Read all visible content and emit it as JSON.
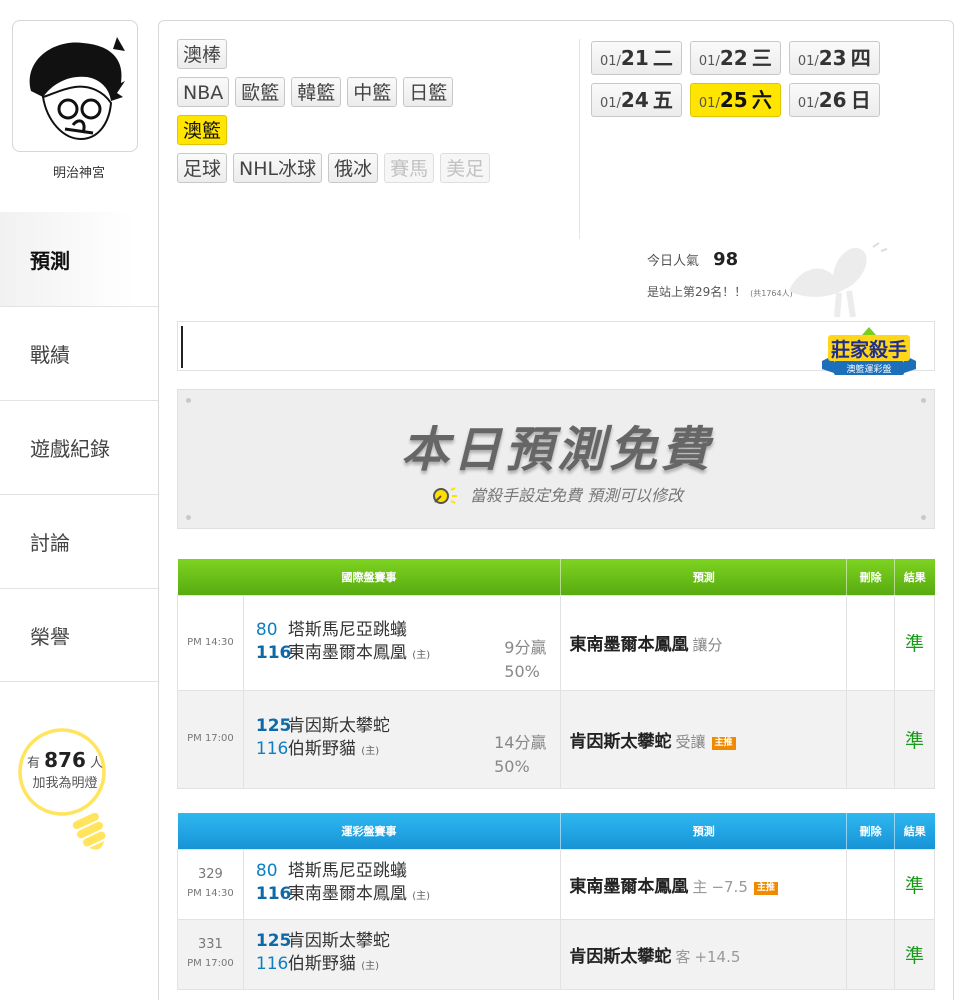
{
  "profile": {
    "name": "明治神宮"
  },
  "nav": {
    "items": [
      "預測",
      "戰績",
      "遊戲紀錄",
      "討論",
      "榮譽"
    ],
    "active_index": 0
  },
  "followers": {
    "prefix": "有",
    "count": "876",
    "suffix": "人",
    "caption": "加我為明燈"
  },
  "sports": {
    "rows": [
      [
        {
          "label": "澳棒",
          "state": "normal"
        }
      ],
      [
        {
          "label": "NBA",
          "state": "normal"
        },
        {
          "label": "歐籃",
          "state": "normal"
        },
        {
          "label": "韓籃",
          "state": "normal"
        },
        {
          "label": "中籃",
          "state": "normal"
        },
        {
          "label": "日籃",
          "state": "normal"
        }
      ],
      [
        {
          "label": "澳籃",
          "state": "active"
        }
      ],
      [
        {
          "label": "足球",
          "state": "normal"
        },
        {
          "label": "NHL冰球",
          "state": "normal"
        },
        {
          "label": "俄冰",
          "state": "normal"
        },
        {
          "label": "賽馬",
          "state": "disabled"
        },
        {
          "label": "美足",
          "state": "disabled"
        }
      ]
    ]
  },
  "dates": [
    {
      "md": "01/",
      "day": "21",
      "wd": "二",
      "active": false
    },
    {
      "md": "01/",
      "day": "22",
      "wd": "三",
      "active": false
    },
    {
      "md": "01/",
      "day": "23",
      "wd": "四",
      "active": false
    },
    {
      "md": "01/",
      "day": "24",
      "wd": "五",
      "active": false
    },
    {
      "md": "01/",
      "day": "25",
      "wd": "六",
      "active": true
    },
    {
      "md": "01/",
      "day": "26",
      "wd": "日",
      "active": false
    }
  ],
  "popularity": {
    "label": "今日人氣",
    "value": "98",
    "rank_text": "是站上第29名！！",
    "rank_total": "(共1764人)"
  },
  "badge": {
    "title": "莊家殺手",
    "subtitle": "澳籃運彩盤"
  },
  "banner": {
    "title": "本日預測免費",
    "subtitle": "當殺手設定免費 預測可以修改"
  },
  "intl_table": {
    "headers": [
      "國際盤賽事",
      "預測",
      "刪除",
      "結果"
    ],
    "accent": "#6cc11a",
    "rows": [
      {
        "time": "PM 14:30",
        "teams": [
          {
            "score": "80",
            "name": "塔斯馬尼亞跳蟻",
            "home": "",
            "win": false
          },
          {
            "score": "116",
            "name": "東南墨爾本鳳凰",
            "home": "(主)",
            "win": true
          }
        ],
        "margin": "9分贏",
        "pct": "50%",
        "pick": "東南墨爾本鳳凰",
        "pick_type": "讓分",
        "main_tag": "",
        "result": "準"
      },
      {
        "time": "PM 17:00",
        "teams": [
          {
            "score": "125",
            "name": "肯因斯太攀蛇",
            "home": "",
            "win": true
          },
          {
            "score": "116",
            "name": "伯斯野貓",
            "home": "(主)",
            "win": false
          }
        ],
        "margin": "14分贏",
        "pct": "50%",
        "pick": "肯因斯太攀蛇",
        "pick_type": "受讓",
        "main_tag": "主推",
        "result": "準"
      }
    ]
  },
  "sports_table": {
    "headers": [
      "運彩盤賽事",
      "預測",
      "刪除",
      "結果"
    ],
    "accent": "#1fa3e3",
    "rows": [
      {
        "num": "329",
        "time": "PM 14:30",
        "teams": [
          {
            "score": "80",
            "name": "塔斯馬尼亞跳蟻",
            "home": "",
            "win": false
          },
          {
            "score": "116",
            "name": "東南墨爾本鳳凰",
            "home": "(主)",
            "win": true
          }
        ],
        "pick": "東南墨爾本鳳凰",
        "side": "主",
        "line": "−7.5",
        "main_tag": "主推",
        "result": "準"
      },
      {
        "num": "331",
        "time": "PM 17:00",
        "teams": [
          {
            "score": "125",
            "name": "肯因斯太攀蛇",
            "home": "",
            "win": true
          },
          {
            "score": "116",
            "name": "伯斯野貓",
            "home": "(主)",
            "win": false
          }
        ],
        "pick": "肯因斯太攀蛇",
        "side": "客",
        "line": "+14.5",
        "main_tag": "",
        "result": "準"
      }
    ]
  }
}
